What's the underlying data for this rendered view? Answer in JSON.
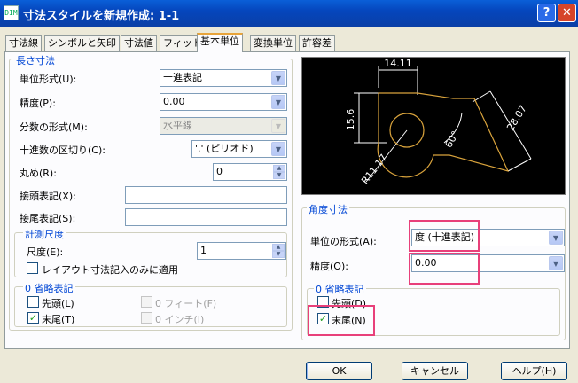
{
  "window": {
    "title": "寸法スタイルを新規作成: 1-1",
    "icon_text": "DIM",
    "help_label": "?",
    "close_label": "✕"
  },
  "tabs": [
    "寸法線",
    "シンボルと矢印",
    "寸法値",
    "フィット",
    "基本単位",
    "変換単位",
    "許容差"
  ],
  "active_tab": "基本単位",
  "linear": {
    "group_label": "長さ寸法",
    "unit_format_label": "単位形式(U):",
    "unit_format_value": "十進表記",
    "precision_label": "精度(P):",
    "precision_value": "0.00",
    "fraction_label": "分数の形式(M):",
    "fraction_value": "水平線",
    "decimal_sep_label": "十進数の区切り(C):",
    "decimal_sep_value": "'.' (ピリオド)",
    "round_label": "丸め(R):",
    "round_value": "0",
    "prefix_label": "接頭表記(X):",
    "prefix_value": "",
    "suffix_label": "接尾表記(S):",
    "suffix_value": "",
    "scale_group_label": "計測尺度",
    "scale_label": "尺度(E):",
    "scale_value": "1",
    "layout_only_label": "レイアウト寸法記入のみに適用",
    "zero_group_label": "0 省略表記",
    "leading_label": "先頭(L)",
    "trailing_label": "末尾(T)",
    "feet_label": "0 フィート(F)",
    "inch_label": "0 インチ(I)"
  },
  "preview": {
    "dim_top": "14.11",
    "dim_left": "15.6",
    "dim_right": "28.07",
    "dim_angle": "60°",
    "dim_radius": "R11.17"
  },
  "angular": {
    "group_label": "角度寸法",
    "unit_format_label": "単位の形式(A):",
    "unit_format_value": "度 (十進表記)",
    "precision_label": "精度(O):",
    "precision_value": "0.00",
    "zero_group_label": "0 省略表記",
    "leading_label": "先頭(D)",
    "trailing_label": "末尾(N)"
  },
  "checks": {
    "layout_only": false,
    "linear_leading": false,
    "linear_trailing": true,
    "feet": false,
    "inch": false,
    "angular_leading": false,
    "angular_trailing": true
  },
  "buttons": {
    "ok": "OK",
    "cancel": "キャンセル",
    "help": "ヘルプ(H)"
  }
}
